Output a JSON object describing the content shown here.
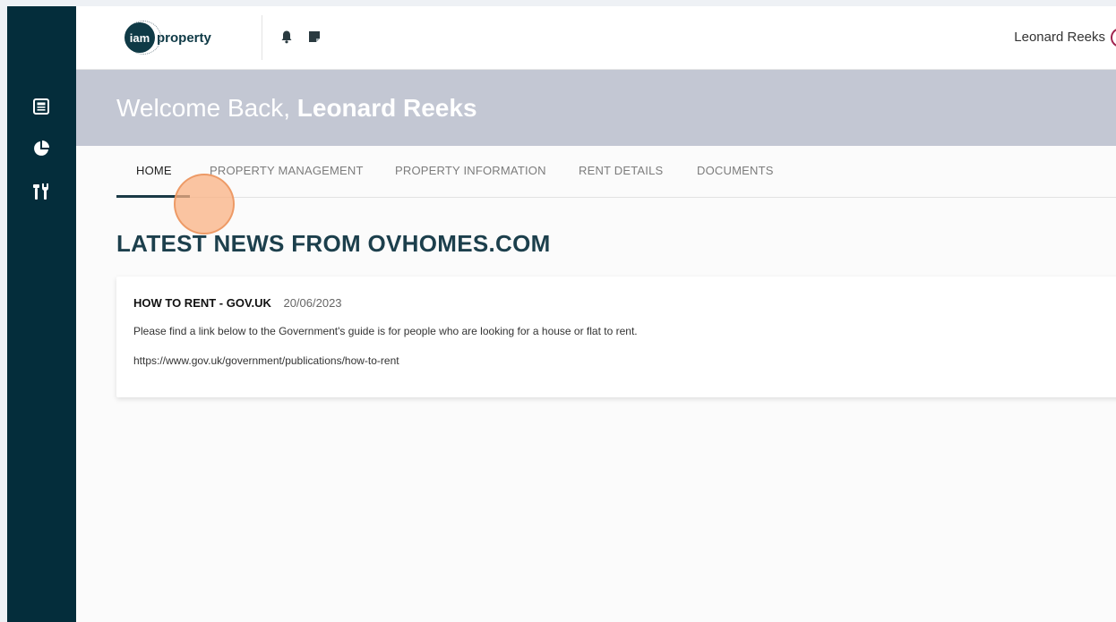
{
  "header": {
    "logo_circle_text": "iam",
    "logo_text": "property",
    "user_name": "Leonard Reeks",
    "icons": [
      "bell-icon",
      "note-icon"
    ]
  },
  "sidebar": {
    "icons": [
      "newspaper-icon",
      "pie-chart-icon",
      "tools-icon"
    ]
  },
  "banner": {
    "greeting": "Welcome Back, ",
    "name": "Leonard Reeks"
  },
  "tabs": [
    {
      "label": "HOME",
      "active": true
    },
    {
      "label": "PROPERTY MANAGEMENT",
      "active": false
    },
    {
      "label": "PROPERTY INFORMATION",
      "active": false
    },
    {
      "label": "RENT DETAILS",
      "active": false
    },
    {
      "label": "DOCUMENTS",
      "active": false
    }
  ],
  "section_title": "LATEST NEWS FROM OVHOMES.COM",
  "news": [
    {
      "title": "HOW TO RENT - GOV.UK",
      "date": "20/06/2023",
      "body": "Please find a link below to the Government's guide is for people who are looking for a house or flat to rent.",
      "link": "https://www.gov.uk/government/publications/how-to-rent"
    }
  ],
  "colors": {
    "sidebar": "#042d3b",
    "banner": "#c3c7d3",
    "accent": "#1c3f4c"
  }
}
